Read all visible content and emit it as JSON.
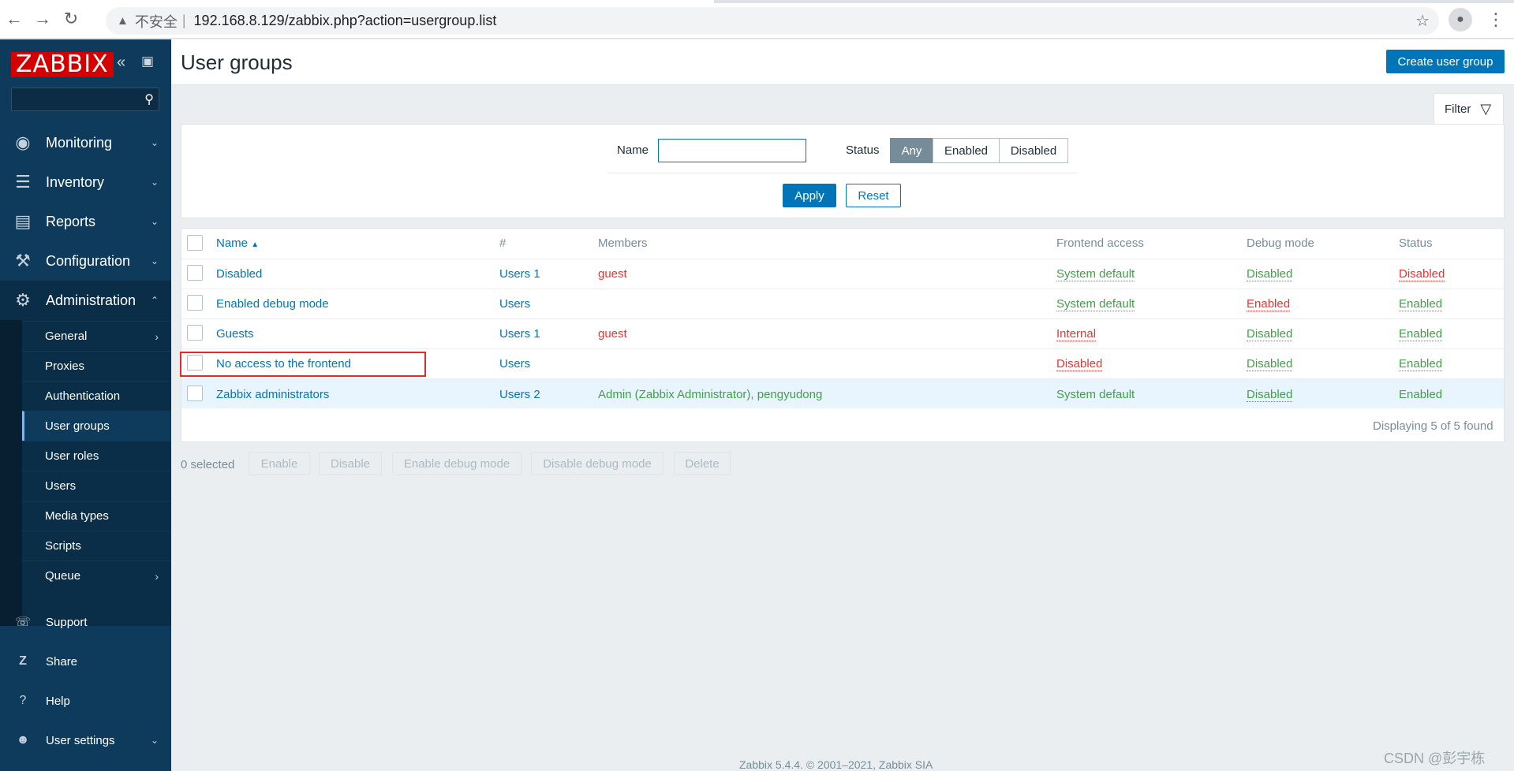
{
  "browser": {
    "security_label": "不安全",
    "url": "192.168.8.129/zabbix.php?action=usergroup.list"
  },
  "sidebar": {
    "logo": "ZABBIX",
    "menu": [
      {
        "label": "Monitoring",
        "icon": "eye-icon"
      },
      {
        "label": "Inventory",
        "icon": "list-icon"
      },
      {
        "label": "Reports",
        "icon": "bar-chart-icon"
      },
      {
        "label": "Configuration",
        "icon": "wrench-icon"
      },
      {
        "label": "Administration",
        "icon": "gear-icon"
      }
    ],
    "submenu": [
      {
        "label": "General"
      },
      {
        "label": "Proxies"
      },
      {
        "label": "Authentication"
      },
      {
        "label": "User groups"
      },
      {
        "label": "User roles"
      },
      {
        "label": "Users"
      },
      {
        "label": "Media types"
      },
      {
        "label": "Scripts"
      },
      {
        "label": "Queue"
      }
    ],
    "footer": [
      {
        "label": "Support",
        "icon": "headset-icon"
      },
      {
        "label": "Share",
        "icon": "share-icon"
      },
      {
        "label": "Help",
        "icon": "help-icon"
      },
      {
        "label": "User settings",
        "icon": "user-icon"
      }
    ]
  },
  "header": {
    "title": "User groups",
    "create_button": "Create user group"
  },
  "filter": {
    "tab_label": "Filter",
    "name_label": "Name",
    "name_value": "",
    "status_label": "Status",
    "status_options": [
      "Any",
      "Enabled",
      "Disabled"
    ],
    "status_selected": "Any",
    "apply": "Apply",
    "reset": "Reset"
  },
  "table": {
    "columns": {
      "name": "Name",
      "count": "#",
      "members": "Members",
      "frontend": "Frontend access",
      "debug": "Debug mode",
      "status": "Status"
    },
    "rows": [
      {
        "name": "Disabled",
        "users": "Users 1",
        "members": "guest",
        "frontend": "System default",
        "debug": "Disabled",
        "status": "Disabled"
      },
      {
        "name": "Enabled debug mode",
        "users": "Users",
        "members": "",
        "frontend": "System default",
        "debug": "Enabled",
        "status": "Enabled"
      },
      {
        "name": "Guests",
        "users": "Users 1",
        "members": "guest",
        "frontend": "Internal",
        "debug": "Disabled",
        "status": "Enabled"
      },
      {
        "name": "No access to the frontend",
        "users": "Users",
        "members": "",
        "frontend": "Disabled",
        "debug": "Disabled",
        "status": "Enabled"
      },
      {
        "name": "Zabbix administrators",
        "users": "Users 2",
        "members": "Admin (Zabbix Administrator), pengyudong",
        "frontend": "System default",
        "debug": "Disabled",
        "status": "Enabled"
      }
    ],
    "paging": "Displaying 5 of 5 found"
  },
  "actions": {
    "selected": "0 selected",
    "buttons": [
      "Enable",
      "Disable",
      "Enable debug mode",
      "Disable debug mode",
      "Delete"
    ]
  },
  "footer": "Zabbix 5.4.4. © 2001–2021, Zabbix SIA",
  "watermark": "CSDN @彭宇栋"
}
